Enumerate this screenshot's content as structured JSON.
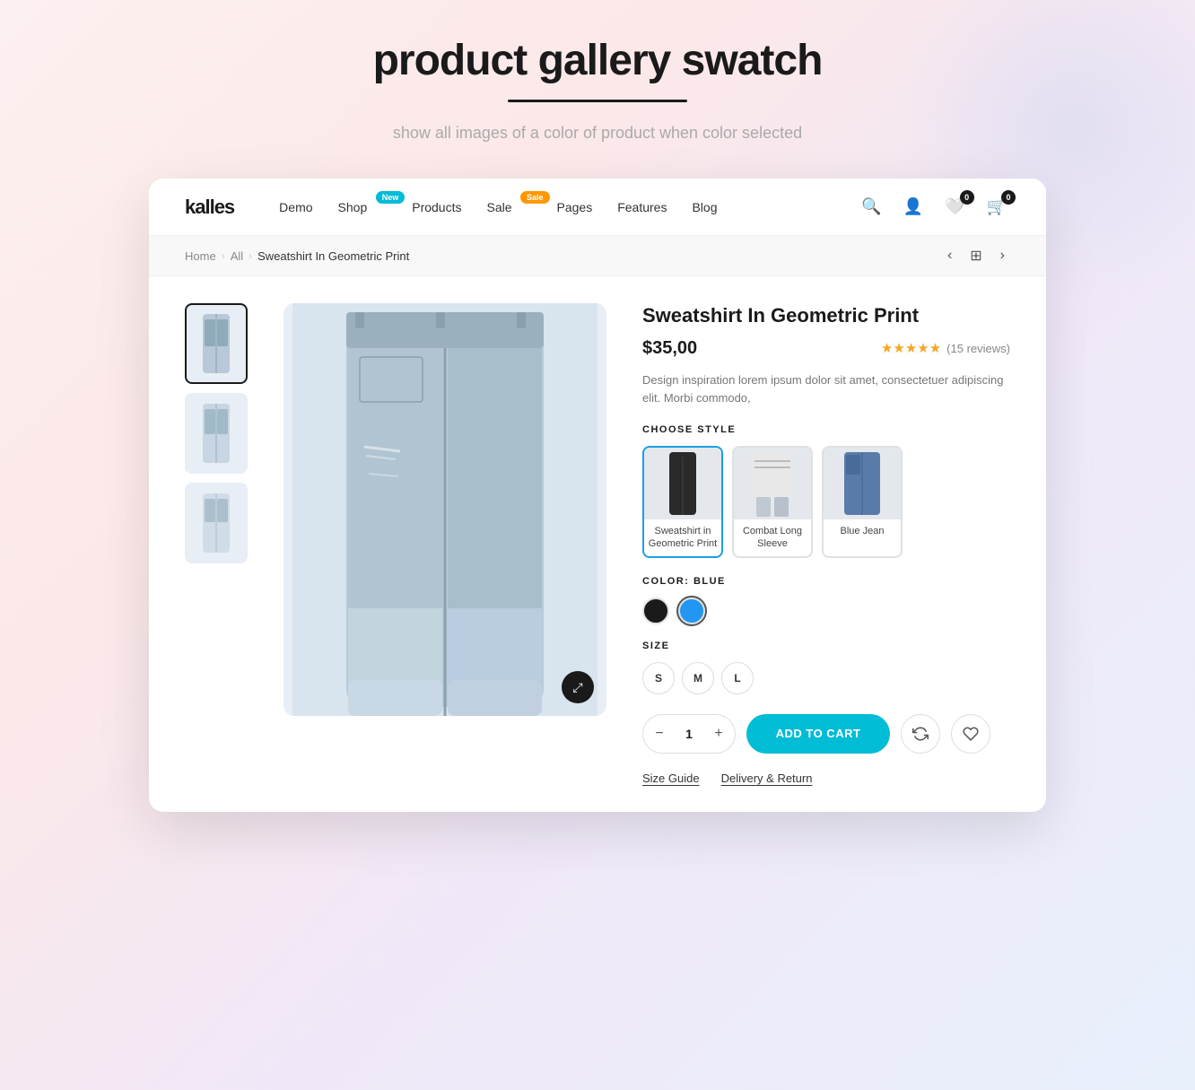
{
  "hero": {
    "title": "product gallery swatch",
    "subtitle": "show all images of a color of product when color selected"
  },
  "nav": {
    "logo": "kalles",
    "links": [
      {
        "label": "Demo",
        "badge": null
      },
      {
        "label": "Shop",
        "badge": {
          "text": "New",
          "type": "new"
        }
      },
      {
        "label": "Products",
        "badge": null
      },
      {
        "label": "Sale",
        "badge": {
          "text": "Sale",
          "type": "sale"
        }
      },
      {
        "label": "Pages",
        "badge": null
      },
      {
        "label": "Features",
        "badge": null
      },
      {
        "label": "Blog",
        "badge": null
      }
    ],
    "cart_count": "0",
    "wishlist_count": "0"
  },
  "breadcrumb": {
    "items": [
      "Home",
      "All",
      "Sweatshirt In Geometric Print"
    ]
  },
  "product": {
    "title": "Sweatshirt In Geometric Print",
    "price": "$35,00",
    "rating": "15 reviews",
    "stars": "★★★★★",
    "description": "Design inspiration lorem ipsum dolor sit amet, consectetuer adipiscing elit. Morbi commodo,",
    "choose_style_label": "CHOOSE STYLE",
    "styles": [
      {
        "label": "Sweatshirt in\nGeometric Print",
        "active": true
      },
      {
        "label": "Combat Long Sleeve",
        "active": false
      },
      {
        "label": "Blue Jean",
        "active": false
      }
    ],
    "color_label": "COLOR: BLUE",
    "colors": [
      {
        "name": "black",
        "hex": "#1a1a1a",
        "active": false
      },
      {
        "name": "blue",
        "hex": "#2196f3",
        "active": true
      }
    ],
    "size_label": "SIZE",
    "sizes": [
      "S",
      "M",
      "L"
    ],
    "quantity": "1",
    "add_to_cart": "ADD TO CART",
    "size_guide": "Size Guide",
    "delivery_return": "Delivery & Return"
  }
}
